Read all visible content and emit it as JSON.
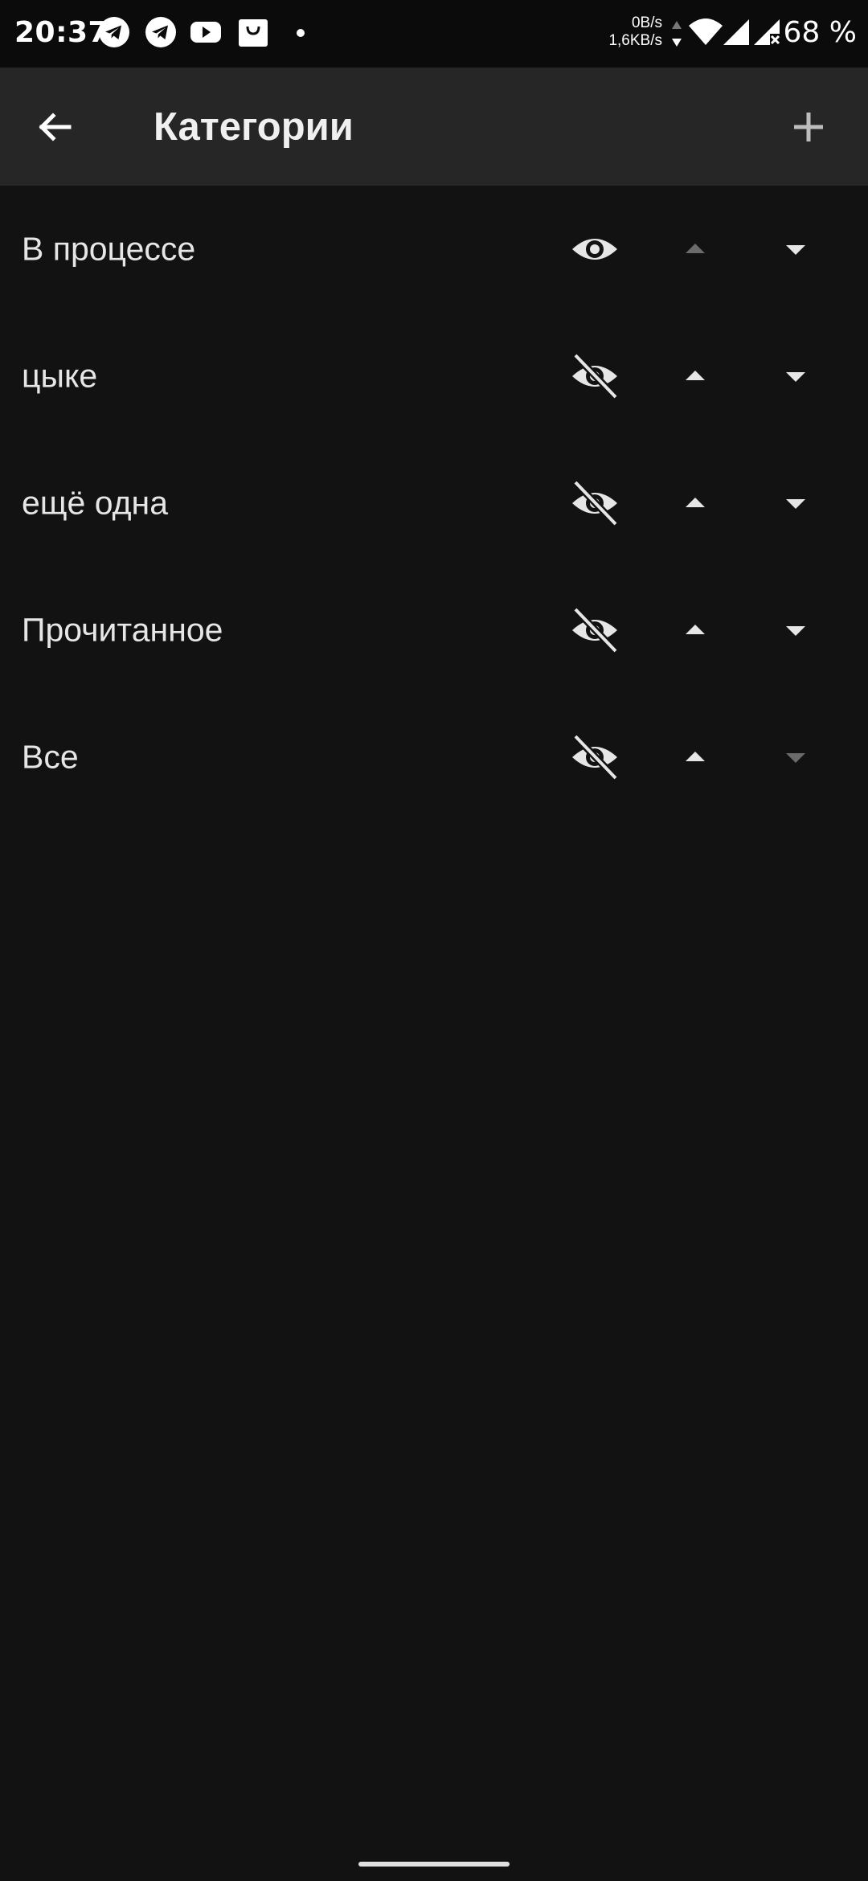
{
  "status_bar": {
    "time": "20:37",
    "notification_icons": [
      "telegram-icon",
      "telegram-icon",
      "youtube-icon",
      "shopping-bag-icon"
    ],
    "net_up": "0B/s",
    "net_down": "1,6KB/s",
    "battery": "68 %"
  },
  "app_bar": {
    "title": "Категории",
    "back_icon": "arrow-back-icon",
    "add_icon": "add-icon"
  },
  "categories": [
    {
      "name": "В процессе",
      "visible": true,
      "up_enabled": false,
      "down_enabled": true
    },
    {
      "name": "цыке",
      "visible": false,
      "up_enabled": true,
      "down_enabled": true
    },
    {
      "name": "ещё одна",
      "visible": false,
      "up_enabled": true,
      "down_enabled": true
    },
    {
      "name": "Прочитанное",
      "visible": false,
      "up_enabled": true,
      "down_enabled": true
    },
    {
      "name": "Все",
      "visible": false,
      "up_enabled": true,
      "down_enabled": false
    }
  ],
  "colors": {
    "background": "#121212",
    "app_bar": "#262626",
    "status_bar": "#0b0b0b",
    "icon_enabled": "#e6e6e6",
    "icon_disabled": "#6b6b6b"
  }
}
